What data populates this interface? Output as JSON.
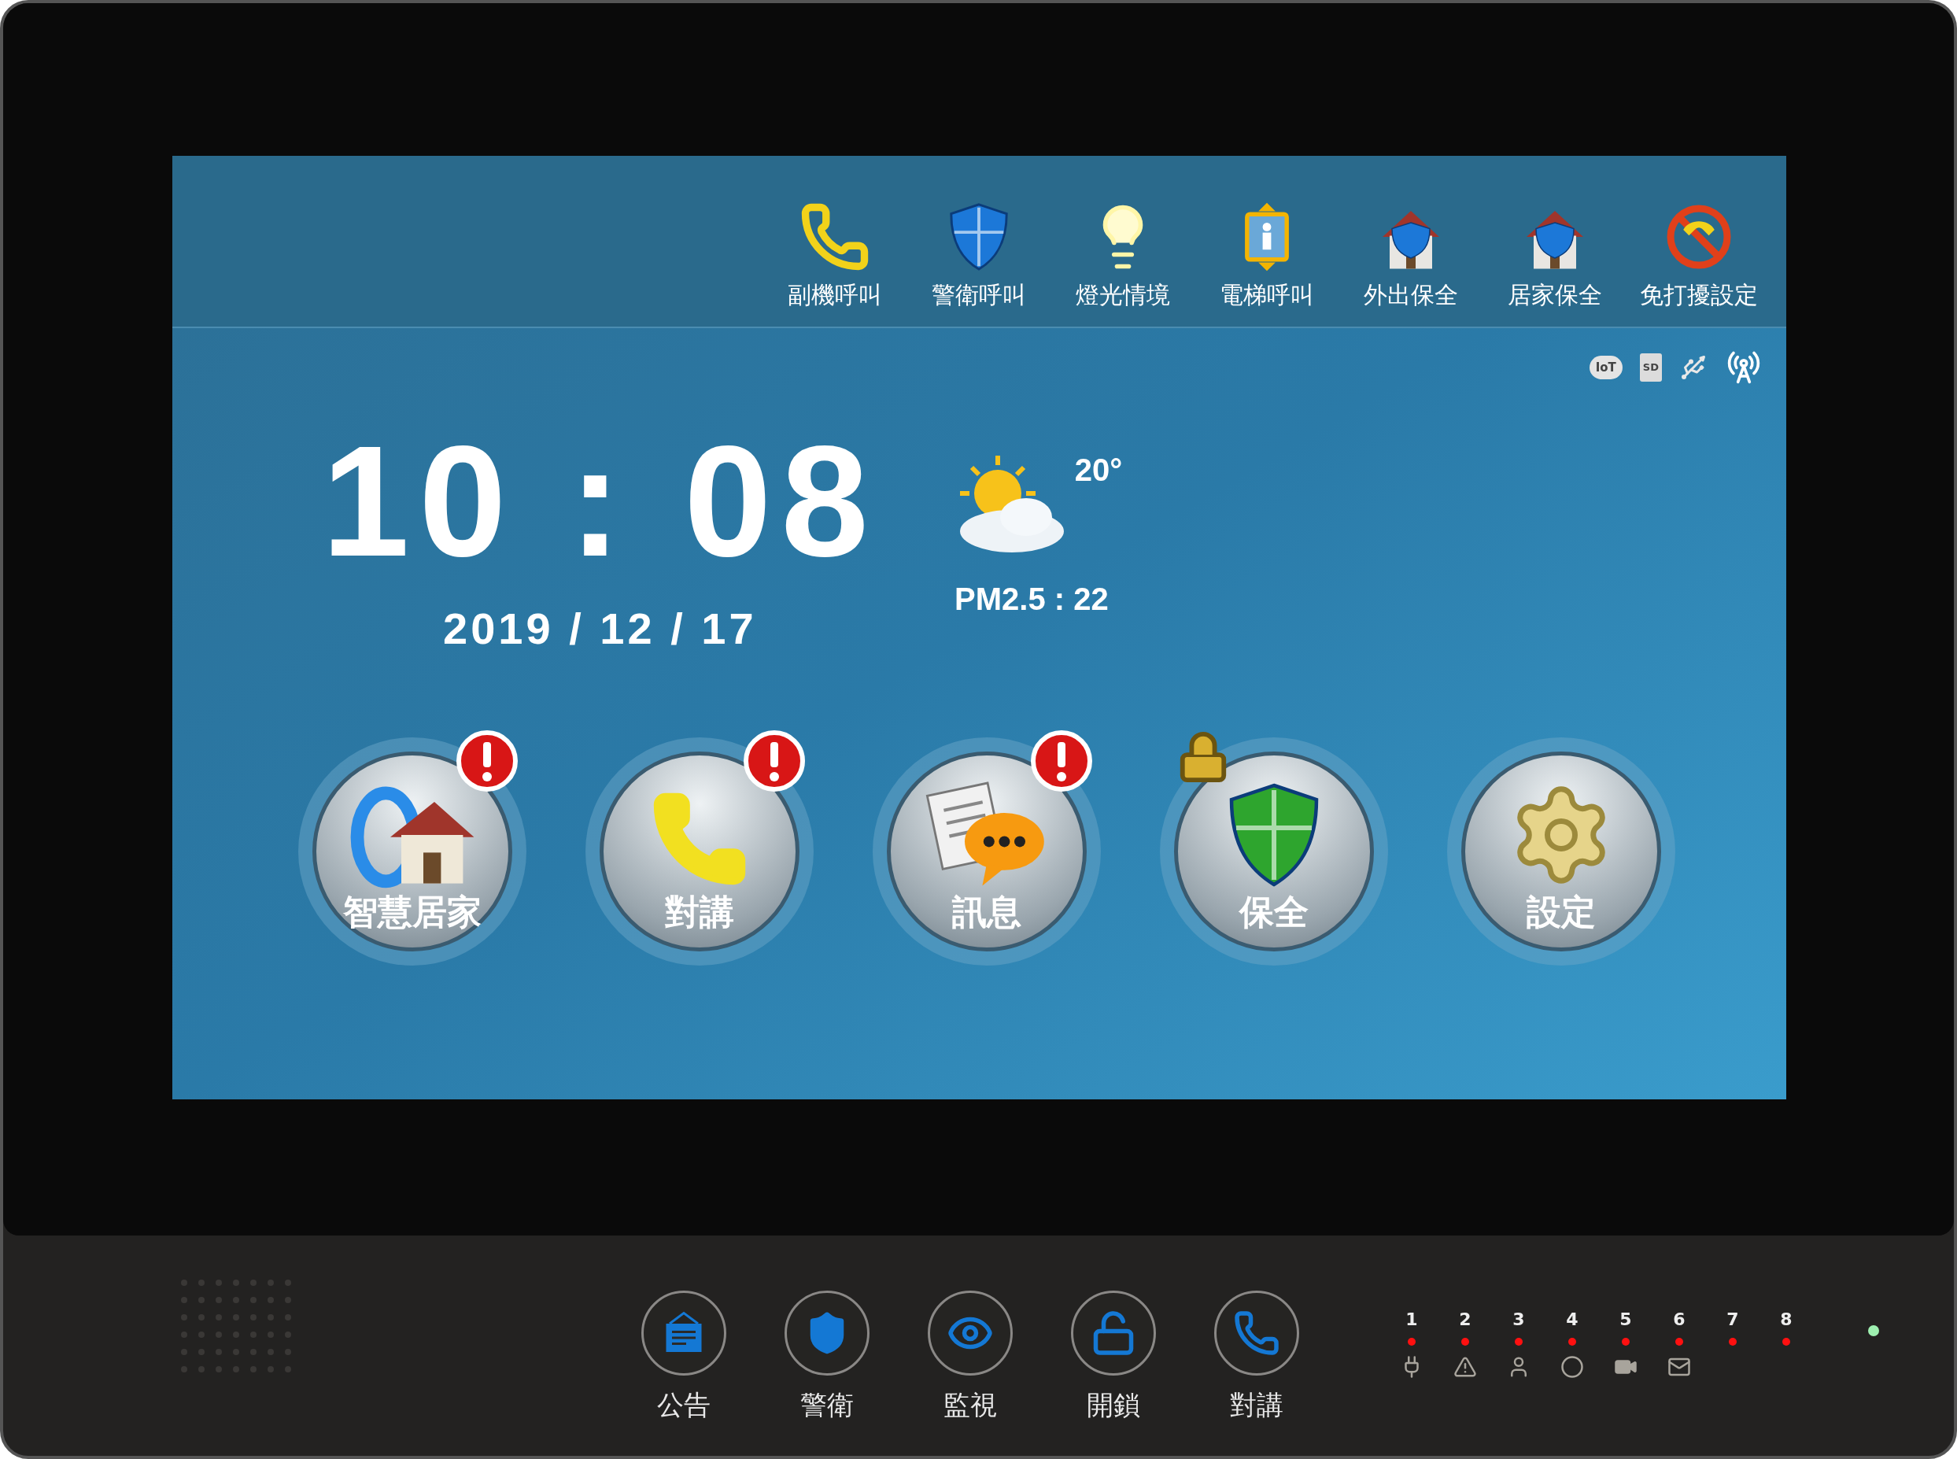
{
  "top_bar": {
    "items": [
      {
        "kind": "intercom-call",
        "label": "副機呼叫"
      },
      {
        "kind": "guard-call",
        "label": "警衛呼叫"
      },
      {
        "kind": "lighting",
        "label": "燈光情境"
      },
      {
        "kind": "elevator-call",
        "label": "電梯呼叫"
      },
      {
        "kind": "away-security",
        "label": "外出保全"
      },
      {
        "kind": "home-security",
        "label": "居家保全"
      },
      {
        "kind": "do-not-disturb",
        "label": "免打擾設定"
      }
    ]
  },
  "status_icons": [
    {
      "kind": "cloud",
      "label": "IoT"
    },
    {
      "kind": "sd",
      "label": "SD"
    },
    {
      "kind": "usb"
    },
    {
      "kind": "antenna"
    }
  ],
  "clock": {
    "time": "10 : 08",
    "date": "2019 / 12 / 17"
  },
  "weather": {
    "temperature": "20°",
    "pm25": "PM2.5 : 22"
  },
  "main_buttons": [
    {
      "kind": "smart-home",
      "label": "智慧居家",
      "alert": true,
      "locked": false
    },
    {
      "kind": "intercom",
      "label": "對講",
      "alert": true,
      "locked": false
    },
    {
      "kind": "message",
      "label": "訊息",
      "alert": true,
      "locked": false
    },
    {
      "kind": "security",
      "label": "保全",
      "alert": false,
      "locked": true
    },
    {
      "kind": "settings",
      "label": "設定",
      "alert": false,
      "locked": false
    }
  ],
  "hardware_buttons": [
    {
      "kind": "notice",
      "label": "公告"
    },
    {
      "kind": "guard",
      "label": "警衛"
    },
    {
      "kind": "monitor",
      "label": "監視"
    },
    {
      "kind": "unlock",
      "label": "開鎖"
    },
    {
      "kind": "intercom",
      "label": "對講"
    }
  ],
  "indicators": [
    {
      "number": "1",
      "kind": "plug"
    },
    {
      "number": "2",
      "kind": "warning"
    },
    {
      "number": "3",
      "kind": "person"
    },
    {
      "number": "4",
      "kind": "circle"
    },
    {
      "number": "5",
      "kind": "camera"
    },
    {
      "number": "6",
      "kind": "envelope"
    },
    {
      "number": "7",
      "kind": "none"
    },
    {
      "number": "8",
      "kind": "none"
    }
  ],
  "power_led": {
    "on": true
  }
}
